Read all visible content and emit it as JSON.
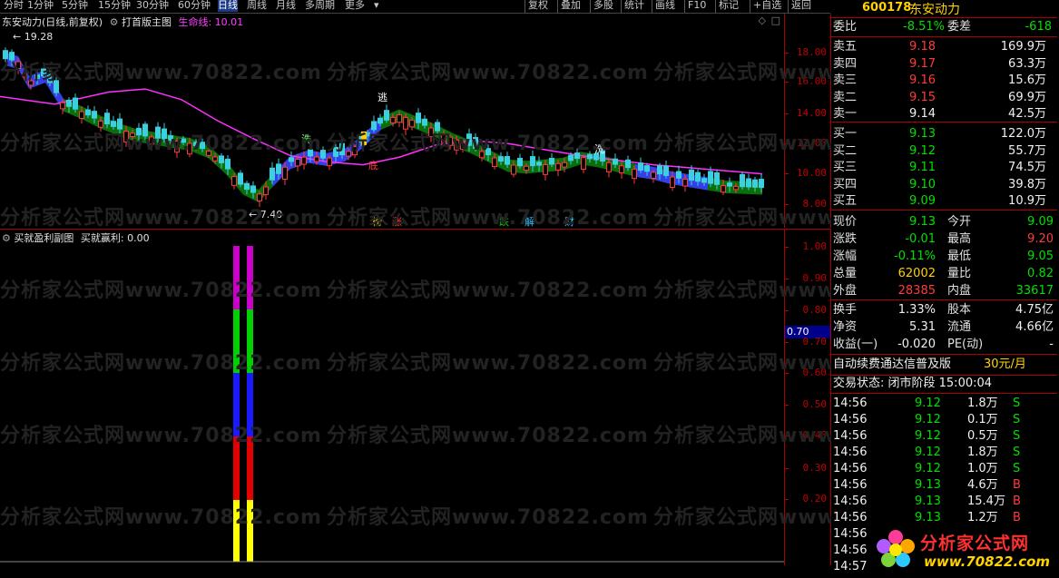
{
  "toolbar": {
    "items": [
      "分时",
      "1分钟",
      "5分钟",
      "15分钟",
      "30分钟",
      "60分钟",
      "日线",
      "周线",
      "月线",
      "多周期",
      "更多",
      "复权",
      "叠加",
      "多股",
      "统计",
      "画线",
      "F10",
      "标记",
      "+自选",
      "返回"
    ],
    "active_index": 6
  },
  "main_chart": {
    "stock_title": "东安动力",
    "period_label": "(日线,前复权)",
    "indicator_name": "打首版主图",
    "life_line_label": "生命线: 10.01",
    "high_label": "19.28",
    "low_label": "7.40",
    "signals": [
      "洗",
      "逃",
      "底",
      "洗"
    ],
    "event_tags": [
      "榜",
      "涨",
      "跌",
      "解",
      "财"
    ],
    "axis": [
      "18.00",
      "16.00",
      "14.00",
      "12.00",
      "10.00",
      "8.00"
    ]
  },
  "sub_chart": {
    "title": "买就盈利副图",
    "value_label": "买就赢利: 0.00",
    "current_marker": "0.70",
    "axis": [
      "1.00",
      "0.90",
      "0.80",
      "0.70",
      "0.60",
      "0.50",
      "0.40",
      "0.30",
      "0.20"
    ]
  },
  "watermark": "分析家公式网www.70822.com",
  "panel": {
    "code": "600178",
    "name": "东安动力",
    "weibi_label": "委比",
    "weibi_value": "-8.51%",
    "weicha_label": "委差",
    "weicha_value": "-618",
    "asks": [
      {
        "label": "卖五",
        "price": "9.18",
        "vol": "169.9万"
      },
      {
        "label": "卖四",
        "price": "9.17",
        "vol": "63.3万"
      },
      {
        "label": "卖三",
        "price": "9.16",
        "vol": "15.6万"
      },
      {
        "label": "卖二",
        "price": "9.15",
        "vol": "69.9万"
      },
      {
        "label": "卖一",
        "price": "9.14",
        "vol": "42.5万"
      }
    ],
    "bids": [
      {
        "label": "买一",
        "price": "9.13",
        "vol": "122.0万"
      },
      {
        "label": "买二",
        "price": "9.12",
        "vol": "55.7万"
      },
      {
        "label": "买三",
        "price": "9.11",
        "vol": "74.5万"
      },
      {
        "label": "买四",
        "price": "9.10",
        "vol": "39.8万"
      },
      {
        "label": "买五",
        "price": "9.09",
        "vol": "10.9万"
      }
    ],
    "quote": [
      {
        "l1": "现价",
        "v1": "9.13",
        "c1": "green",
        "l2": "今开",
        "v2": "9.09",
        "c2": "green"
      },
      {
        "l1": "涨跌",
        "v1": "-0.01",
        "c1": "green",
        "l2": "最高",
        "v2": "9.20",
        "c2": "red"
      },
      {
        "l1": "涨幅",
        "v1": "-0.11%",
        "c1": "green",
        "l2": "最低",
        "v2": "9.05",
        "c2": "green"
      },
      {
        "l1": "总量",
        "v1": "62002",
        "c1": "yellow",
        "l2": "量比",
        "v2": "0.82",
        "c2": "green"
      },
      {
        "l1": "外盘",
        "v1": "28385",
        "c1": "red",
        "l2": "内盘",
        "v2": "33617",
        "c2": "green"
      }
    ],
    "fundamentals": [
      {
        "l1": "换手",
        "v1": "1.33%",
        "l2": "股本",
        "v2": "4.75亿"
      },
      {
        "l1": "净资",
        "v1": "5.31",
        "l2": "流通",
        "v2": "4.66亿"
      },
      {
        "l1": "收益(一)",
        "v1": "-0.020",
        "l2": "PE(动)",
        "v2": "-"
      }
    ],
    "ad_text": "自动续费通达信普及版",
    "ad_price": "30元/月",
    "trade_status": "交易状态: 闭市阶段 15:00:04",
    "ticks": [
      {
        "time": "14:56",
        "price": "9.12",
        "vol": "1.8万",
        "side": "S"
      },
      {
        "time": "14:56",
        "price": "9.12",
        "vol": "0.1万",
        "side": "S"
      },
      {
        "time": "14:56",
        "price": "9.12",
        "vol": "0.5万",
        "side": "S"
      },
      {
        "time": "14:56",
        "price": "9.12",
        "vol": "1.8万",
        "side": "S"
      },
      {
        "time": "14:56",
        "price": "9.12",
        "vol": "1.0万",
        "side": "S"
      },
      {
        "time": "14:56",
        "price": "9.13",
        "vol": "4.6万",
        "side": "B"
      },
      {
        "time": "14:56",
        "price": "9.13",
        "vol": "15.4万",
        "side": "B"
      },
      {
        "time": "14:56",
        "price": "9.13",
        "vol": "1.2万",
        "side": "B"
      },
      {
        "time": "14:56",
        "price": "",
        "vol": "",
        "side": ""
      },
      {
        "time": "14:56",
        "price": "",
        "vol": "",
        "side": ""
      },
      {
        "time": "14:57",
        "price": "",
        "vol": "",
        "side": ""
      }
    ],
    "logo_text": "分析家公式网",
    "logo_url_text": "www.70822.com"
  }
}
